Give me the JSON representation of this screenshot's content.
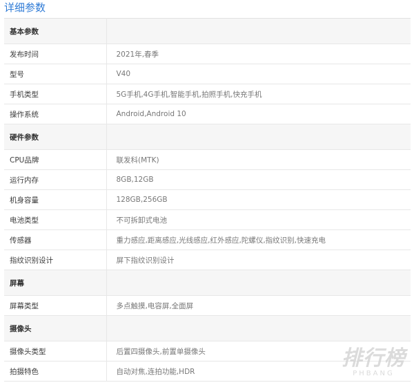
{
  "title": "详细参数",
  "sections": [
    {
      "name": "基本参数",
      "rows": [
        {
          "key": "发布时间",
          "value": "2021年,春季"
        },
        {
          "key": "型号",
          "value": "V40"
        },
        {
          "key": "手机类型",
          "value": "5G手机,4G手机,智能手机,拍照手机,快充手机"
        },
        {
          "key": "操作系统",
          "value": "Android,Android 10"
        }
      ]
    },
    {
      "name": "硬件参数",
      "rows": [
        {
          "key": "CPU品牌",
          "value": "联发科(MTK)"
        },
        {
          "key": "运行内存",
          "value": "8GB,12GB"
        },
        {
          "key": "机身容量",
          "value": "128GB,256GB"
        },
        {
          "key": "电池类型",
          "value": "不可拆卸式电池"
        },
        {
          "key": "传感器",
          "value": "重力感应,距离感应,光线感应,红外感应,陀螺仪,指纹识别,快速充电"
        },
        {
          "key": "指纹识别设计",
          "value": "屏下指纹识别设计"
        }
      ]
    },
    {
      "name": "屏幕",
      "rows": [
        {
          "key": "屏幕类型",
          "value": "多点触摸,电容屏,全面屏"
        }
      ]
    },
    {
      "name": "摄像头",
      "rows": [
        {
          "key": "摄像头类型",
          "value": "后置四摄像头,前置单摄像头"
        },
        {
          "key": "拍摄特色",
          "value": "自动对焦,连拍功能,HDR"
        }
      ]
    }
  ],
  "watermark": {
    "cn": "排行榜",
    "en": "PHBANG"
  }
}
